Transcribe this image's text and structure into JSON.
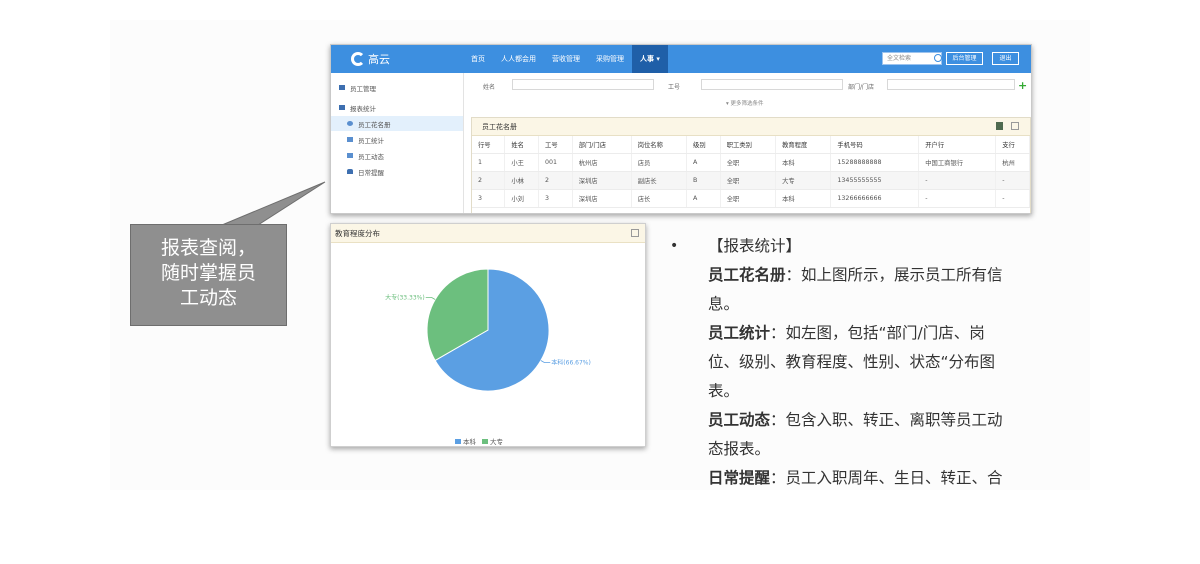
{
  "app": {
    "logo": "高云",
    "nav": [
      "首页",
      "人人都会用",
      "营收管理",
      "采购管理",
      "人事"
    ],
    "active_nav": "人事",
    "search_placeholder": "全文检索",
    "buttons": [
      "后台管理",
      "退出"
    ],
    "sidebar": [
      {
        "label": "员工管理",
        "icon": "folder-icon"
      },
      {
        "label": "报表统计",
        "icon": "folder-open-icon"
      },
      {
        "label": "员工花名册",
        "icon": "report-icon",
        "active": true
      },
      {
        "label": "员工统计",
        "icon": "chart-icon"
      },
      {
        "label": "员工动态",
        "icon": "doc-icon"
      },
      {
        "label": "日常提醒",
        "icon": "bell-icon"
      }
    ],
    "filters": {
      "name": "姓名",
      "id": "工号",
      "dept": "部门/门店",
      "more": "更多筛选条件"
    },
    "panel_title": "员工花名册",
    "columns": [
      "行号",
      "姓名",
      "工号",
      "部门/门店",
      "岗位名称",
      "级别",
      "职工类别",
      "教育程度",
      "手机号码",
      "开户行",
      "支行"
    ],
    "rows": [
      [
        "1",
        "小王",
        "001",
        "杭州店",
        "店员",
        "A",
        "全职",
        "本科",
        "15288888888",
        "中国工商银行",
        "杭州"
      ],
      [
        "2",
        "小林",
        "2",
        "深圳店",
        "副店长",
        "B",
        "全职",
        "大专",
        "13455555555",
        "-",
        "-"
      ],
      [
        "3",
        "小刘",
        "3",
        "深圳店",
        "店长",
        "A",
        "全职",
        "本科",
        "13266666666",
        "-",
        "-"
      ]
    ]
  },
  "callout": {
    "lines": [
      "报表查阅，",
      "随时掌握员",
      "工动态"
    ]
  },
  "chart_data": {
    "type": "pie",
    "title": "教育程度分布",
    "slices": [
      {
        "name": "本科",
        "value": 66.67,
        "label": "本科(66.67%)",
        "color": "#5b9fe3"
      },
      {
        "name": "大专",
        "value": 33.33,
        "label": "大专(33.33%)",
        "color": "#6cbf7e"
      }
    ],
    "legend": [
      "本科",
      "大专"
    ],
    "legend_position": "bottom"
  },
  "notes": {
    "heading": "【报表统计】",
    "s1_title": "员工花名册",
    "s1_text": "：如上图所示，展示员工所有信",
    "s1_cont": "息。",
    "s2_title": "员工统计",
    "s2_text": "：如左图，包括“部门/门店、岗",
    "s2_cont1": "位、级别、教育程度、性别、状态“分布图",
    "s2_cont2": "表。",
    "s3_title": "员工动态",
    "s3_text": "：包含入职、转正、离职等员工动",
    "s3_cont": "态报表。",
    "s4_title": "日常提醒",
    "s4_text": "：员工入职周年、生日、转正、合"
  }
}
